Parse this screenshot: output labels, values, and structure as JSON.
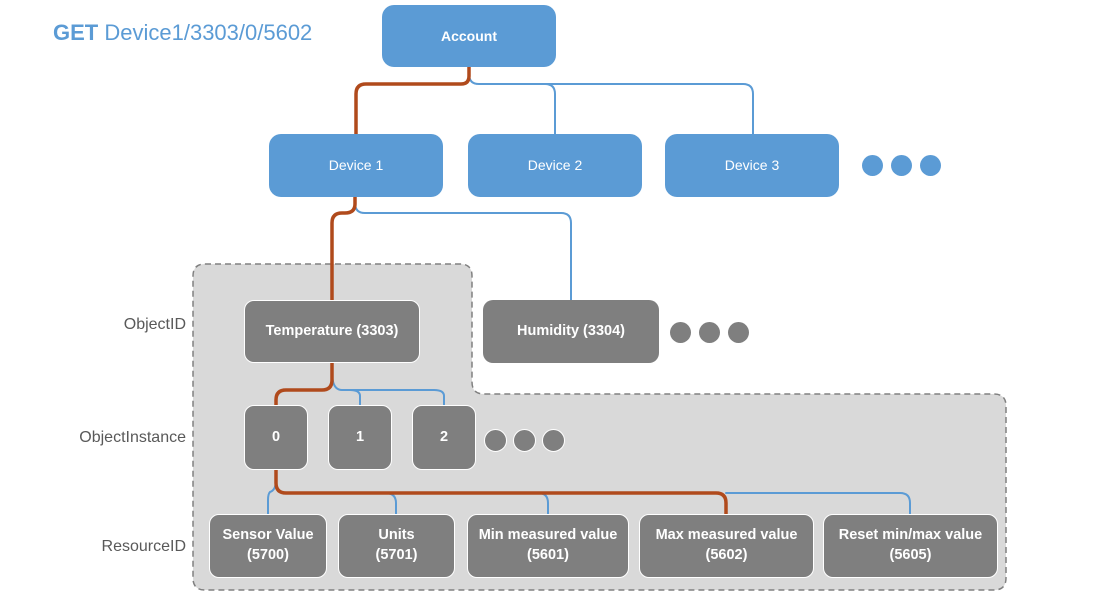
{
  "title": {
    "verb": "GET",
    "path": "Device1/3303/0/5602"
  },
  "colors": {
    "account_device_fill": "#5b9bd5",
    "object_fill": "#7f7f7f",
    "container_fill": "#d9d9d9",
    "container_border": "#808080",
    "selected_path": "#b04a1c",
    "other_path": "#5b9bd5",
    "label_text": "#595959"
  },
  "row_labels": {
    "object_id": "ObjectID",
    "object_instance": "ObjectInstance",
    "resource_id": "ResourceID"
  },
  "account": {
    "label": "Account"
  },
  "devices": [
    {
      "label": "Device 1",
      "selected": true
    },
    {
      "label": "Device 2",
      "selected": false
    },
    {
      "label": "Device 3",
      "selected": false
    }
  ],
  "objects": [
    {
      "label": "Temperature (3303)",
      "selected": true
    },
    {
      "label": "Humidity (3304)",
      "selected": false
    }
  ],
  "instances": [
    {
      "label": "0",
      "selected": true
    },
    {
      "label": "1",
      "selected": false
    },
    {
      "label": "2",
      "selected": false
    }
  ],
  "resources": [
    {
      "name": "Sensor Value",
      "id": "(5700)",
      "selected": false
    },
    {
      "name": "Units",
      "id": "(5701)",
      "selected": false
    },
    {
      "name": "Min measured value",
      "id": "(5601)",
      "selected": false
    },
    {
      "name": "Max measured value",
      "id": "(5602)",
      "selected": true
    },
    {
      "name": "Reset min/max value",
      "id": "(5605)",
      "selected": false
    }
  ],
  "ellipsis": {
    "devices": "more-devices",
    "objects": "more-objects",
    "instances": "more-instances"
  }
}
